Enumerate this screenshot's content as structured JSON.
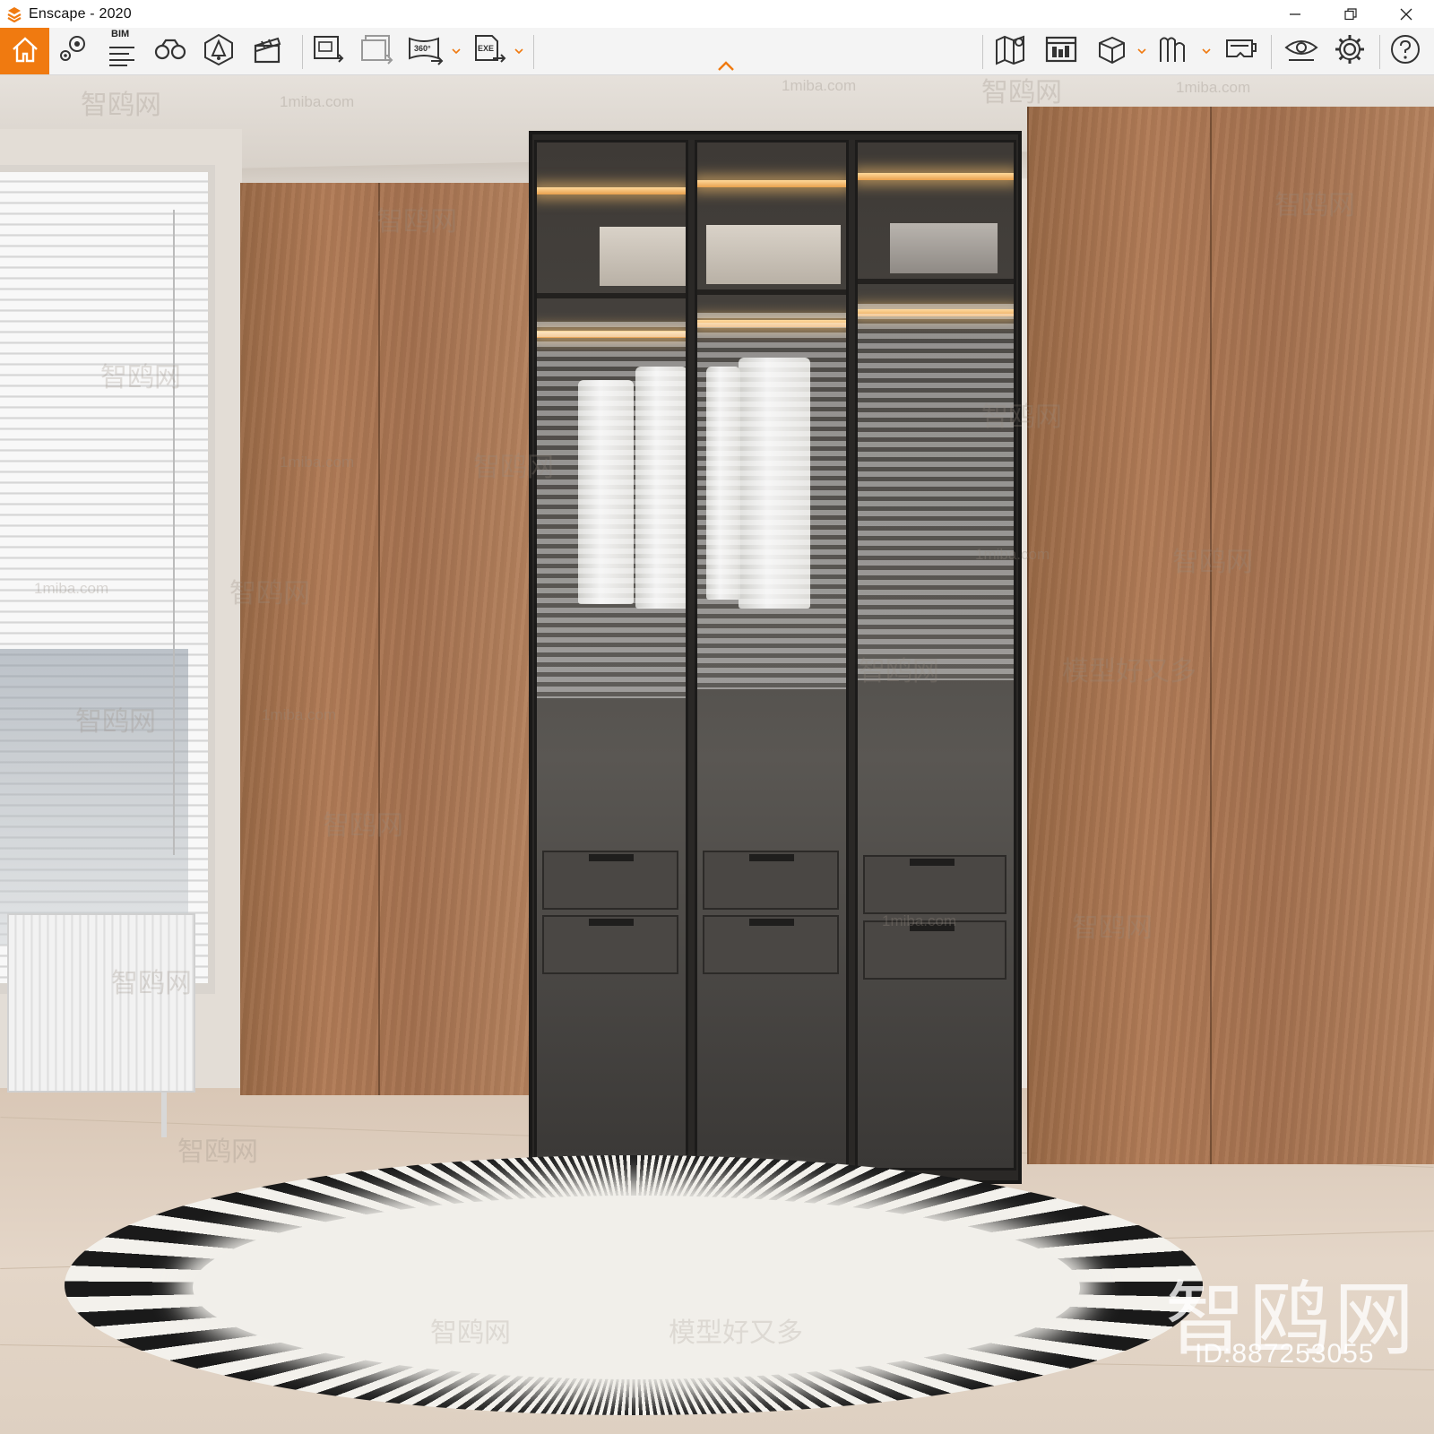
{
  "window": {
    "title": "Enscape - 2020",
    "logo_icon": "enscape-logo-icon",
    "accent_color": "#f07a10",
    "controls": [
      "minimize",
      "restore",
      "close"
    ]
  },
  "toolbar": {
    "left_group": [
      {
        "name": "home",
        "icon": "home-icon",
        "active": true
      },
      {
        "name": "views",
        "icon": "location-pin-icon"
      },
      {
        "name": "bim",
        "icon": "bim-list-icon",
        "label": "BIM"
      },
      {
        "name": "binoculars",
        "icon": "binoculars-icon"
      },
      {
        "name": "light-view",
        "icon": "light-cone-icon"
      },
      {
        "name": "video-editor",
        "icon": "clapperboard-icon"
      }
    ],
    "export_group": [
      {
        "name": "export-image",
        "icon": "image-export-icon"
      },
      {
        "name": "batch-render",
        "icon": "batch-render-icon"
      },
      {
        "name": "panorama",
        "icon": "panorama-360-icon",
        "label": "360°",
        "has_menu": true
      },
      {
        "name": "export-exe",
        "icon": "exe-export-icon",
        "label": "EXE",
        "has_menu": true
      }
    ],
    "right_group": [
      {
        "name": "map",
        "icon": "map-pin-icon"
      },
      {
        "name": "web-viewer",
        "icon": "web-viewer-icon"
      },
      {
        "name": "asset-library",
        "icon": "cube-icon",
        "has_menu": true
      },
      {
        "name": "materials",
        "icon": "material-editor-icon",
        "has_menu": true
      },
      {
        "name": "vr-headset",
        "icon": "vr-headset-icon"
      },
      {
        "name": "visual-settings",
        "icon": "eye-icon"
      },
      {
        "name": "settings",
        "icon": "gear-icon"
      },
      {
        "name": "help",
        "icon": "help-icon"
      }
    ],
    "collapse_icon": "chevron-up-icon"
  },
  "viewport": {
    "scene": "walk-in wardrobe render",
    "watermarks": {
      "cn_site": "智鸥网",
      "url": "1miba.com",
      "slogan": "模型好又多",
      "big_mark": "智鸥网",
      "id_text": "ID:887253055"
    }
  }
}
